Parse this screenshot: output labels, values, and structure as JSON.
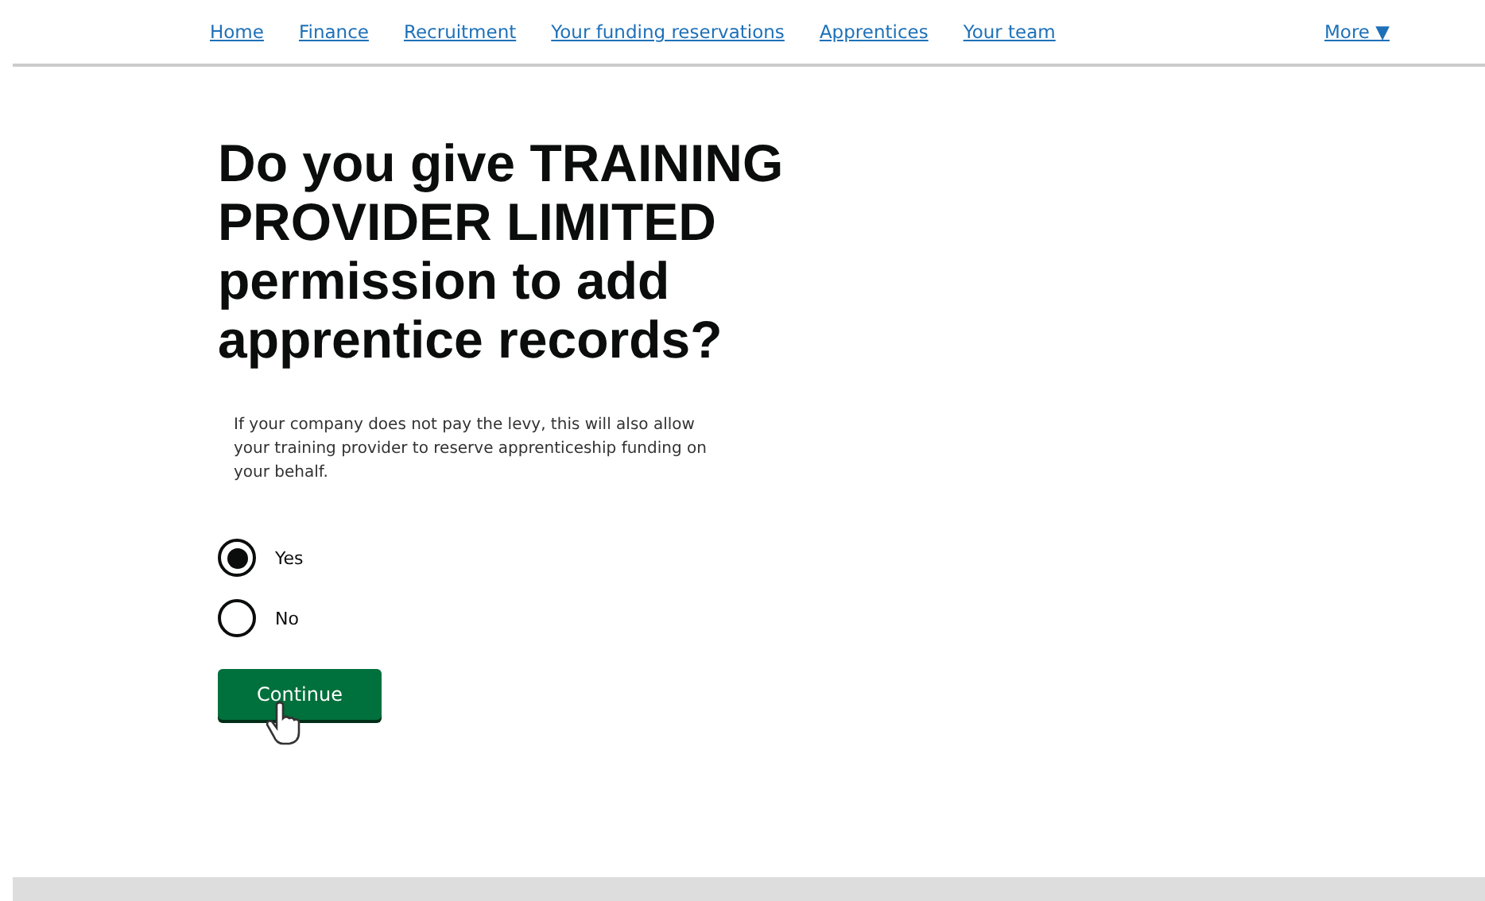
{
  "nav": {
    "links": [
      "Home",
      "Finance",
      "Recruitment",
      "Your funding reservations",
      "Apprentices",
      "Your team"
    ],
    "more": {
      "label": "More",
      "caret": "▼"
    }
  },
  "heading": "Do you give TRAINING PROVIDER LIMITED permission to add apprentice records?",
  "hint": "If your company does not pay the levy, this will also allow your training provider to reserve apprenticeship funding on your behalf.",
  "options": [
    {
      "label": "Yes",
      "selected": true
    },
    {
      "label": "No",
      "selected": false
    }
  ],
  "button": "Continue"
}
